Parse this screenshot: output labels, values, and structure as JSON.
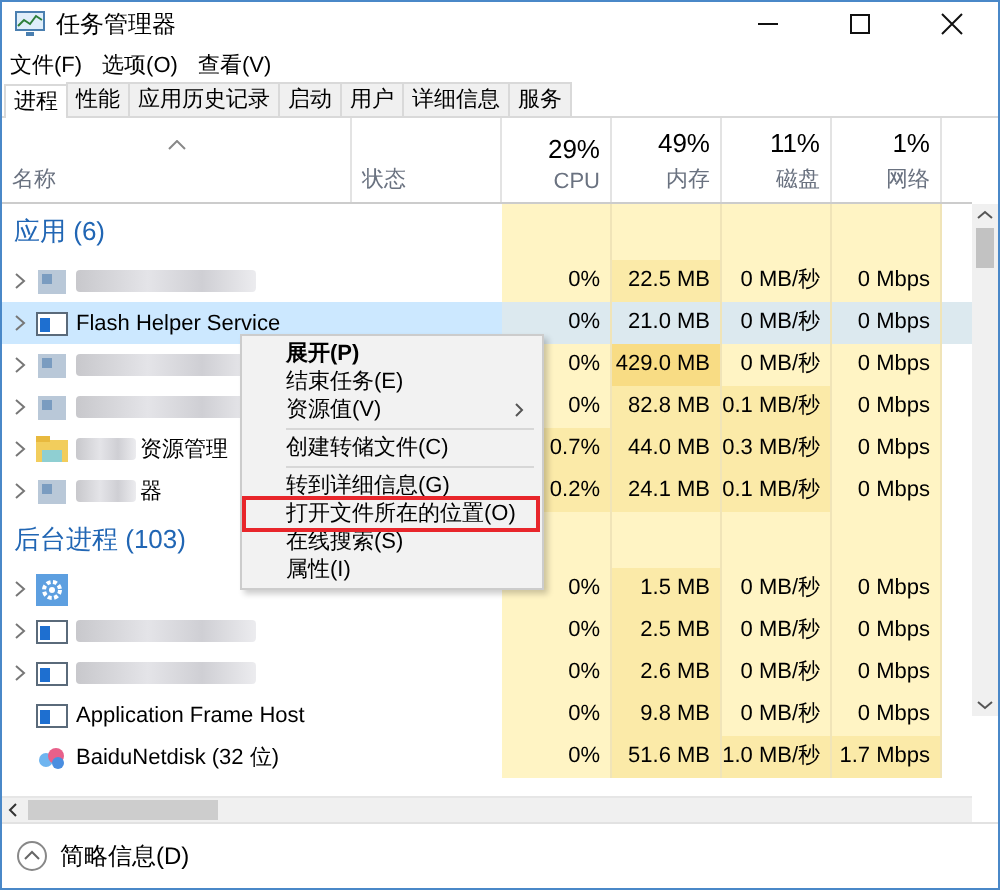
{
  "window": {
    "title": "任务管理器"
  },
  "menu": [
    "文件(F)",
    "选项(O)",
    "查看(V)"
  ],
  "tabs": [
    {
      "label": "进程",
      "selected": true
    },
    {
      "label": "性能",
      "selected": false
    },
    {
      "label": "应用历史记录",
      "selected": false
    },
    {
      "label": "启动",
      "selected": false
    },
    {
      "label": "用户",
      "selected": false
    },
    {
      "label": "详细信息",
      "selected": false
    },
    {
      "label": "服务",
      "selected": false
    }
  ],
  "columns": [
    {
      "label": "名称",
      "sorted": true
    },
    {
      "label": "状态",
      "sorted": false
    },
    {
      "label": "CPU",
      "total": "29%",
      "sorted": false
    },
    {
      "label": "内存",
      "total": "49%",
      "sorted": false
    },
    {
      "label": "磁盘",
      "total": "11%",
      "sorted": false
    },
    {
      "label": "网络",
      "total": "1%",
      "sorted": false
    }
  ],
  "groups": [
    {
      "title": "应用 (6)",
      "rows": [
        {
          "kind": "app",
          "blurred": true,
          "expandable": true,
          "selected": false,
          "cells": [
            {
              "text": "0%",
              "color": "#fff4c4"
            },
            {
              "text": "22.5 MB",
              "color": "#fbeaa8"
            },
            {
              "text": "0 MB/秒",
              "color": "#fff4c4"
            },
            {
              "text": "0 Mbps",
              "color": "#fff4c4"
            }
          ]
        },
        {
          "kind": "window",
          "blurred": false,
          "name": "Flash Helper Service",
          "expandable": true,
          "selected": true,
          "cells": [
            {
              "text": "0%"
            },
            {
              "text": "21.0 MB"
            },
            {
              "text": "0 MB/秒"
            },
            {
              "text": "0 Mbps"
            }
          ]
        },
        {
          "kind": "app",
          "blurred": true,
          "expandable": true,
          "selected": false,
          "cells": [
            {
              "text": "0%",
              "color": "#fff4c4"
            },
            {
              "text": "429.0 MB",
              "color": "#f8dc84"
            },
            {
              "text": "0 MB/秒",
              "color": "#fff4c4"
            },
            {
              "text": "0 Mbps",
              "color": "#fff4c4"
            }
          ]
        },
        {
          "kind": "app",
          "blurred": true,
          "expandable": true,
          "selected": false,
          "cells": [
            {
              "text": "0%",
              "color": "#fff4c4"
            },
            {
              "text": "82.8 MB",
              "color": "#fbeaa8"
            },
            {
              "text": "0.1 MB/秒",
              "color": "#fbeaa8"
            },
            {
              "text": "0 Mbps",
              "color": "#fff4c4"
            }
          ]
        },
        {
          "kind": "folder",
          "blurred": true,
          "name": "资源管理",
          "expandable": true,
          "selected": false,
          "cells": [
            {
              "text": "0.7%",
              "color": "#fbeaa8"
            },
            {
              "text": "44.0 MB",
              "color": "#fbeaa8"
            },
            {
              "text": "0.3 MB/秒",
              "color": "#fbeaa8"
            },
            {
              "text": "0 Mbps",
              "color": "#fff4c4"
            }
          ]
        },
        {
          "kind": "app",
          "blurred": true,
          "name": "器",
          "expandable": true,
          "selected": false,
          "cells": [
            {
              "text": "0.2%",
              "color": "#fbeaa8"
            },
            {
              "text": "24.1 MB",
              "color": "#fbeaa8"
            },
            {
              "text": "0.1 MB/秒",
              "color": "#fbeaa8"
            },
            {
              "text": "0 Mbps",
              "color": "#fff4c4"
            }
          ]
        }
      ]
    },
    {
      "title": "后台进程 (103)",
      "rows": [
        {
          "kind": "gear",
          "blurred": false,
          "expandable": true,
          "selected": false,
          "cells": [
            {
              "text": "0%",
              "color": "#fff4c4"
            },
            {
              "text": "1.5 MB",
              "color": "#fbeaa8"
            },
            {
              "text": "0 MB/秒",
              "color": "#fff4c4"
            },
            {
              "text": "0 Mbps",
              "color": "#fff4c4"
            }
          ]
        },
        {
          "kind": "window",
          "blurred": true,
          "expandable": true,
          "selected": false,
          "cells": [
            {
              "text": "0%",
              "color": "#fff4c4"
            },
            {
              "text": "2.5 MB",
              "color": "#fbeaa8"
            },
            {
              "text": "0 MB/秒",
              "color": "#fff4c4"
            },
            {
              "text": "0 Mbps",
              "color": "#fff4c4"
            }
          ]
        },
        {
          "kind": "window",
          "blurred": true,
          "expandable": true,
          "selected": false,
          "cells": [
            {
              "text": "0%",
              "color": "#fff4c4"
            },
            {
              "text": "2.6 MB",
              "color": "#fbeaa8"
            },
            {
              "text": "0 MB/秒",
              "color": "#fff4c4"
            },
            {
              "text": "0 Mbps",
              "color": "#fff4c4"
            }
          ]
        },
        {
          "kind": "window",
          "blurred": false,
          "name": "Application Frame Host",
          "expandable": false,
          "selected": false,
          "cells": [
            {
              "text": "0%",
              "color": "#fff4c4"
            },
            {
              "text": "9.8 MB",
              "color": "#fbeaa8"
            },
            {
              "text": "0 MB/秒",
              "color": "#fff4c4"
            },
            {
              "text": "0 Mbps",
              "color": "#fff4c4"
            }
          ]
        },
        {
          "kind": "cloud",
          "blurred": false,
          "name": "BaiduNetdisk (32 位)",
          "expandable": false,
          "selected": false,
          "cells": [
            {
              "text": "0%",
              "color": "#fff4c4"
            },
            {
              "text": "51.6 MB",
              "color": "#fbeaa8"
            },
            {
              "text": "1.0 MB/秒",
              "color": "#fbeaa8"
            },
            {
              "text": "1.7 Mbps",
              "color": "#fbeaa8"
            }
          ]
        }
      ]
    }
  ],
  "context_menu": [
    {
      "label": "展开(P)",
      "kind": "item",
      "bold": true,
      "submenu": false,
      "highlighted": false
    },
    {
      "label": "结束任务(E)",
      "kind": "item",
      "bold": false,
      "submenu": false,
      "highlighted": false
    },
    {
      "label": "资源值(V)",
      "kind": "item",
      "bold": false,
      "submenu": true,
      "highlighted": false
    },
    {
      "kind": "separator"
    },
    {
      "label": "创建转储文件(C)",
      "kind": "item",
      "bold": false,
      "submenu": false,
      "highlighted": false
    },
    {
      "kind": "separator"
    },
    {
      "label": "转到详细信息(G)",
      "kind": "item",
      "bold": false,
      "submenu": false,
      "highlighted": false
    },
    {
      "label": "打开文件所在的位置(O)",
      "kind": "item",
      "bold": false,
      "submenu": false,
      "highlighted": true
    },
    {
      "label": "在线搜索(S)",
      "kind": "item",
      "bold": false,
      "submenu": false,
      "highlighted": false
    },
    {
      "label": "属性(I)",
      "kind": "item",
      "bold": false,
      "submenu": false,
      "highlighted": false
    }
  ],
  "footer": {
    "label": "简略信息(D)"
  }
}
